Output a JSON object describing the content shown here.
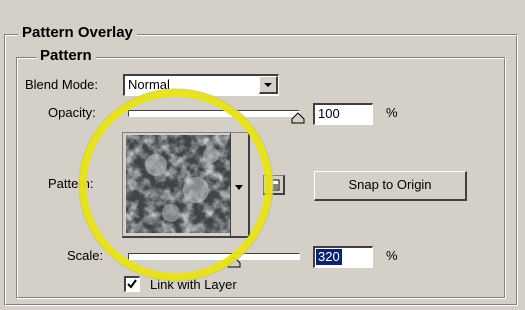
{
  "outer_group": {
    "title": "Pattern Overlay"
  },
  "inner_group": {
    "title": "Pattern"
  },
  "blend_mode": {
    "label": "Blend Mode:",
    "value": "Normal"
  },
  "opacity": {
    "label": "Opacity:",
    "value": "100",
    "unit": "%",
    "level": 1.0
  },
  "pattern": {
    "label": "Pattern:"
  },
  "snap_button": {
    "label": "Snap to Origin"
  },
  "scale": {
    "label": "Scale:",
    "value": "320",
    "unit": "%",
    "level": 0.62
  },
  "link_layer": {
    "label": "Link with Layer",
    "checked": true
  },
  "colors": {
    "panel_bg": "#d4d0c8",
    "highlight_ring": "#e8e21a",
    "selection": "#0a246a"
  }
}
